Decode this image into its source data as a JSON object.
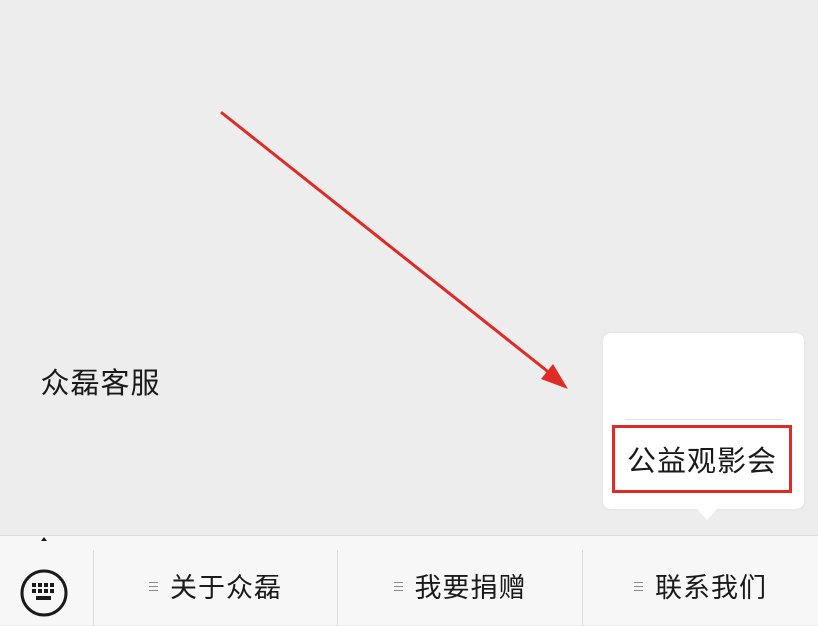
{
  "popup": {
    "items": [
      {
        "label": "众磊客服"
      },
      {
        "label": "公益观影会",
        "highlighted": true
      }
    ],
    "highlight_color": "#e02a26"
  },
  "annotation": {
    "arrow_color": "#e02a26"
  },
  "menubar": {
    "keyboard_icon": "keyboard-icon",
    "items": [
      {
        "label": "关于众磊",
        "icon": "menu-lines-icon"
      },
      {
        "label": "我要捐赠",
        "icon": "menu-lines-icon"
      },
      {
        "label": "联系我们",
        "icon": "menu-lines-icon"
      }
    ]
  },
  "colors": {
    "background": "#ededed",
    "menubar": "#f7f7f7",
    "popup": "#ffffff"
  }
}
